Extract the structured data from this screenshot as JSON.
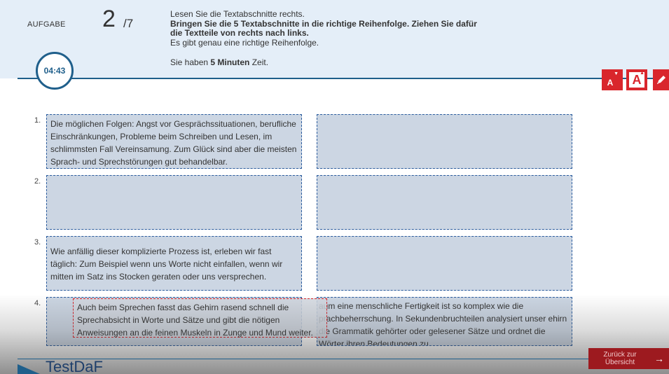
{
  "header": {
    "task_label": "AUFGABE",
    "task_number": "2",
    "task_total": "/7",
    "instruction_line1": "Lesen Sie die Textabschnitte rechts.",
    "instruction_bold": "Bringen Sie die 5 Textabschnitte in die richtige Reihenfolge. Ziehen Sie dafür die Textteile von rechts nach links.",
    "instruction_line3": "Es gibt genau eine richtige Reihenfolge.",
    "time_prefix": "Sie haben ",
    "time_bold": "5 Minuten",
    "time_suffix": " Zeit.",
    "timer": "04:43"
  },
  "tools": {
    "decrease_font": "A",
    "increase_font": "A",
    "highlight_icon": "pen-icon"
  },
  "rows": [
    {
      "number": "1.",
      "left": "Die möglichen Folgen: Angst vor Gesprächssituationen, berufliche Einschränkungen, Probleme beim Schreiben und Lesen, im schlimmsten Fall Vereinsamung. Zum Glück sind aber die meisten Sprach- und Sprechstörungen gut behandelbar.",
      "right": ""
    },
    {
      "number": "2.",
      "left": "",
      "right": ""
    },
    {
      "number": "3.",
      "left": "Wie anfällig dieser komplizierte Prozess ist, erleben wir fast täglich: Zum Beispiel wenn uns Worte nicht einfallen, wenn wir mitten im Satz ins Stocken geraten oder uns versprechen.",
      "right": ""
    },
    {
      "number": "4.",
      "left": "",
      "right": "aum eine menschliche Fertigkeit ist so komplex wie die prachbeherrschung. In Sekundenbruchteilen analysiert unser ehirn die Grammatik gehörter oder gelesener Sätze und ordnet die Wörter ihren Bedeutungen zu."
    }
  ],
  "drag_piece": "Auch beim Sprechen fasst das Gehirn rasend schnell die Sprechabsicht in Worte und Sätze und gibt die nötigen Anweisungen an die feinen Muskeln in Zunge und Mund weiter.",
  "footer": {
    "logo": "TestDaF",
    "back_label": "Zurück zur Übersicht",
    "back_arrow": "→"
  },
  "colors": {
    "accent_blue": "#1f5f8b",
    "accent_red": "#d9262c",
    "slot_bg": "#ccd6e3"
  }
}
